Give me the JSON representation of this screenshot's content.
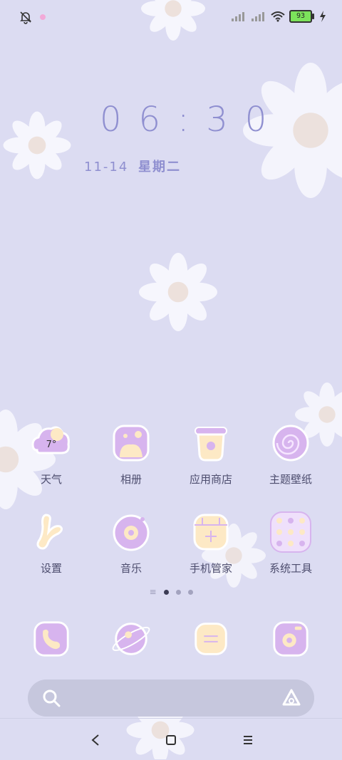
{
  "status_bar": {
    "battery_level": "93",
    "icons": [
      "bell-off-icon",
      "notification-dot",
      "signal-icon",
      "signal-icon",
      "wifi-icon",
      "battery-icon",
      "charging-icon"
    ]
  },
  "clock": {
    "time": "06:30",
    "date": "11-14",
    "weekday": "星期二"
  },
  "home_grid": {
    "rows": [
      [
        {
          "label": "天气",
          "icon": "weather-icon",
          "badge": "7°"
        },
        {
          "label": "相册",
          "icon": "gallery-icon"
        },
        {
          "label": "应用商店",
          "icon": "app-store-icon"
        },
        {
          "label": "主题壁纸",
          "icon": "themes-icon"
        }
      ],
      [
        {
          "label": "设置",
          "icon": "settings-icon"
        },
        {
          "label": "音乐",
          "icon": "music-icon"
        },
        {
          "label": "手机管家",
          "icon": "security-icon"
        },
        {
          "label": "系统工具",
          "icon": "tools-folder-icon"
        }
      ]
    ]
  },
  "pager": {
    "pages": 3,
    "active_page": 1
  },
  "dock": {
    "icons": [
      "phone-icon",
      "browser-icon",
      "messages-icon",
      "camera-icon"
    ]
  },
  "colors": {
    "background": "#dcdcf2",
    "accent_purple": "#d7b4ee",
    "accent_cream": "#fde9c5",
    "text": "#4d4d6e"
  },
  "search_bar": {
    "icons": [
      "search-icon",
      "assistant-icon"
    ]
  },
  "nav_bar": {
    "icons": [
      "back-icon",
      "home-icon",
      "menu-icon"
    ]
  }
}
